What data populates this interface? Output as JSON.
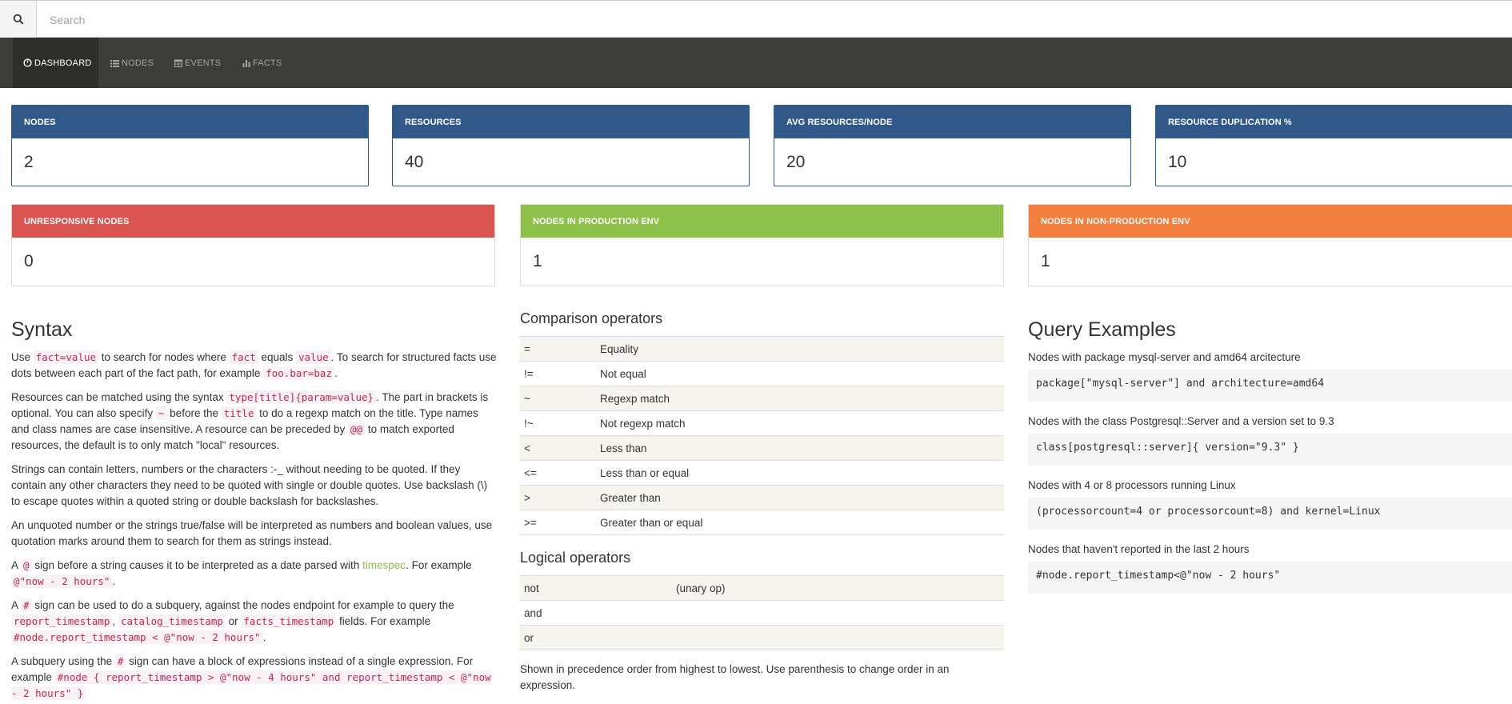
{
  "search": {
    "placeholder": "Search"
  },
  "nav": [
    {
      "label": "DASHBOARD",
      "icon": "dashboard-icon",
      "active": true
    },
    {
      "label": "NODES",
      "icon": "list-icon"
    },
    {
      "label": "EVENTS",
      "icon": "calendar-icon"
    },
    {
      "label": "FACTS",
      "icon": "bar-chart-icon"
    }
  ],
  "stats_top": [
    {
      "label": "NODES",
      "value": "2"
    },
    {
      "label": "RESOURCES",
      "value": "40"
    },
    {
      "label": "AVG RESOURCES/NODE",
      "value": "20"
    },
    {
      "label": "RESOURCE DUPLICATION %",
      "value": "10"
    }
  ],
  "stats_bottom": [
    {
      "label": "UNRESPONSIVE NODES",
      "value": "0",
      "color": "#d9534f"
    },
    {
      "label": "NODES IN PRODUCTION ENV",
      "value": "1",
      "color": "#8dc149"
    },
    {
      "label": "NODES IN NON-PRODUCTION ENV",
      "value": "1",
      "color": "#f47e3e"
    }
  ],
  "syntax": {
    "title": "Syntax",
    "p1": {
      "a": "Use ",
      "c1": "fact=value",
      "b": " to search for nodes where ",
      "c2": "fact",
      "c": " equals ",
      "c3": "value",
      "d": ". To search for structured facts use dots between each part of the fact path, for example ",
      "c4": "foo.bar=baz",
      "e": "."
    },
    "p2": {
      "a": "Resources can be matched using the syntax ",
      "c1": "type[title]{param=value}",
      "b": ". The part in brackets is optional. You can also specify ",
      "c2": "~",
      "c": " before the ",
      "c3": "title",
      "d": " to do a regexp match on the title. Type names and class names are case insensitive. A resource can be preceded by ",
      "c4": "@@",
      "e": " to match exported resources, the default is to only match \"local\" resources."
    },
    "p3": "Strings can contain letters, numbers or the characters :-_ without needing to be quoted. If they contain any other characters they need to be quoted with single or double quotes. Use backslash (\\) to escape quotes within a quoted string or double backslash for backslashes.",
    "p4": "An unquoted number or the strings true/false will be interpreted as numbers and boolean values, use quotation marks around them to search for them as strings instead.",
    "p5": {
      "a": "A ",
      "c1": "@",
      "b": " sign before a string causes it to be interpreted as a date parsed with ",
      "link": "timespec",
      "c": ". For example ",
      "c2": "@\"now - 2 hours\"",
      "d": "."
    },
    "p6": {
      "a": "A ",
      "c1": "#",
      "b": " sign can be used to do a subquery, against the nodes endpoint for example to query the ",
      "c2": "report_timestamp",
      "c": ", ",
      "c3": "catalog_timestamp",
      "d": " or ",
      "c4": "facts_timestamp",
      "e": " fields. For example ",
      "c5": "#node.report_timestamp < @\"now - 2 hours\"",
      "f": "."
    },
    "p7": {
      "a": "A subquery using the ",
      "c1": "#",
      "b": " sign can have a block of expressions instead of a single expression. For example ",
      "c2": "#node { report_timestamp > @\"now - 4 hours\" and report_timestamp < @\"now - 2 hours\" }"
    }
  },
  "comparison": {
    "title": "Comparison operators",
    "rows": [
      {
        "op": "=",
        "desc": "Equality"
      },
      {
        "op": "!=",
        "desc": "Not equal"
      },
      {
        "op": "~",
        "desc": "Regexp match"
      },
      {
        "op": "!~",
        "desc": "Not regexp match"
      },
      {
        "op": "<",
        "desc": "Less than"
      },
      {
        "op": "<=",
        "desc": "Less than or equal"
      },
      {
        "op": ">",
        "desc": "Greater than"
      },
      {
        "op": ">=",
        "desc": "Greater than or equal"
      }
    ]
  },
  "logical": {
    "title": "Logical operators",
    "rows": [
      {
        "op": "not",
        "desc": "(unary op)"
      },
      {
        "op": "and",
        "desc": ""
      },
      {
        "op": "or",
        "desc": ""
      }
    ],
    "note": "Shown in precedence order from highest to lowest. Use parenthesis to change order in an expression."
  },
  "examples": {
    "title": "Query Examples",
    "items": [
      {
        "desc": "Nodes with package mysql-server and amd64 arcitecture",
        "query": "package[\"mysql-server\"] and architecture=amd64"
      },
      {
        "desc": "Nodes with the class Postgresql::Server and a version set to 9.3",
        "query": "class[postgresql::server]{ version=\"9.3\" }"
      },
      {
        "desc": "Nodes with 4 or 8 processors running Linux",
        "query": "(processorcount=4 or processorcount=8) and kernel=Linux"
      },
      {
        "desc": "Nodes that haven't reported in the last 2 hours",
        "query": "#node.report_timestamp<@\"now - 2 hours\""
      }
    ]
  }
}
